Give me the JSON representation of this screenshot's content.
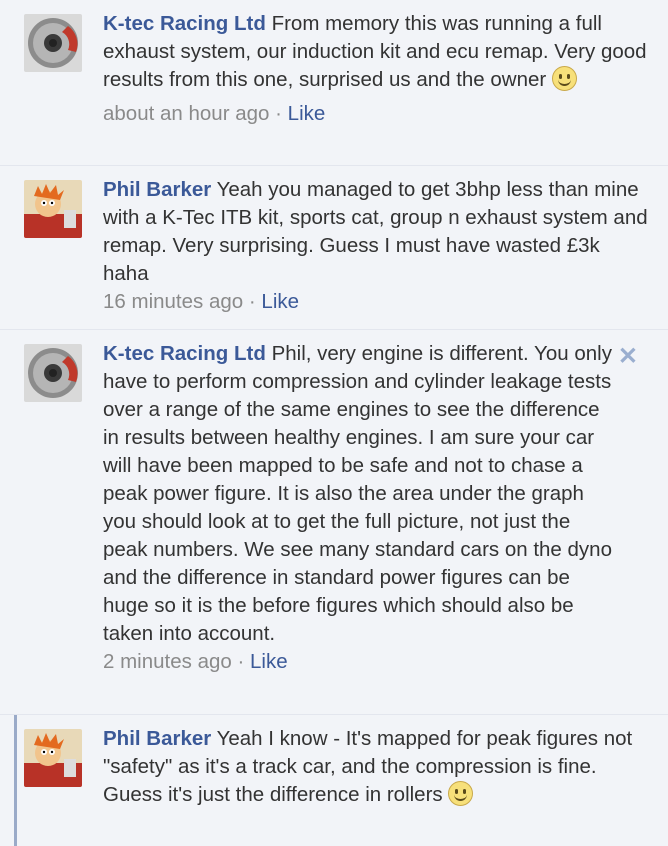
{
  "comments": [
    {
      "author": "K-tec Racing Ltd",
      "text": "From memory this was running a full exhaust system, our induction kit and ecu remap. Very good results from this one, surprised us and the owner",
      "time": "about an hour ago",
      "sep": "·",
      "like": "Like",
      "avatar_icon": "brake-disc-icon"
    },
    {
      "author": "Phil Barker",
      "text": "Yeah you managed to get 3bhp less than mine with a K-Tec ITB kit, sports cat, group n exhaust system and remap. Very surprising. Guess I must have wasted £3k haha",
      "time": "16 minutes ago",
      "sep": "·",
      "like": "Like",
      "avatar_icon": "cartoon-avatar-icon"
    },
    {
      "author": "K-tec Racing Ltd",
      "text": "Phil, very engine is different. You only have to perform compression and cylinder leakage tests over a range of the same engines to see the difference in results between healthy engines. I am sure your car will have been mapped to be safe and not to chase a peak power figure. It is also the area under the graph you should look at to get the full picture, not just the peak numbers. We see many standard cars on the dyno and the difference in standard power figures can be huge so it is the before figures which should also be taken into account.",
      "time": "2 minutes ago",
      "sep": "·",
      "like": "Like",
      "avatar_icon": "brake-disc-icon",
      "close_icon": "✕"
    },
    {
      "author": "Phil Barker",
      "text": "Yeah I know - It's mapped for peak figures not \"safety\" as it's a track car, and the compression is fine. Guess it's just the difference in rollers",
      "avatar_icon": "cartoon-avatar-icon"
    }
  ],
  "colors": {
    "author": "#3b5998",
    "background": "#f2f4f8",
    "meta": "#8a8a8a"
  }
}
